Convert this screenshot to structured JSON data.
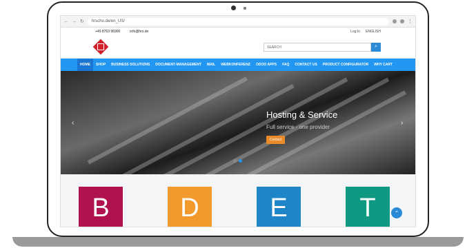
{
  "browser": {
    "url": "hrscho.de/en_US/",
    "lang": "ENGLISH"
  },
  "contact": {
    "phone": "+49 8763 96900",
    "email": "info@hrs.de",
    "left": "Log In",
    "lang": "ENGLISH"
  },
  "search": {
    "placeholder": "SEARCH"
  },
  "nav": [
    "HOME",
    "SHOP",
    "BUSINESS SOLUTIONS",
    "DOCUMENT-MANAGEMENT",
    "MAIL",
    "WEBKONFERENZ",
    "ODOO APPS",
    "FAQ",
    "CONTACT US",
    "PRODUCT CONFIGURATOR",
    "WHY CART"
  ],
  "hero": {
    "title": "Hosting & Service",
    "subtitle": "Full service - one provider",
    "button": "Contact",
    "prev": "‹",
    "next": "›"
  },
  "tiles": [
    {
      "letter": "B",
      "color": "#b0124f"
    },
    {
      "letter": "D",
      "color": "#f39a2d"
    },
    {
      "letter": "E",
      "color": "#1e86c8"
    },
    {
      "letter": "T",
      "color": "#0e9a82"
    }
  ],
  "colors": {
    "nav": "#2196f3",
    "accent": "#e98a2b"
  }
}
